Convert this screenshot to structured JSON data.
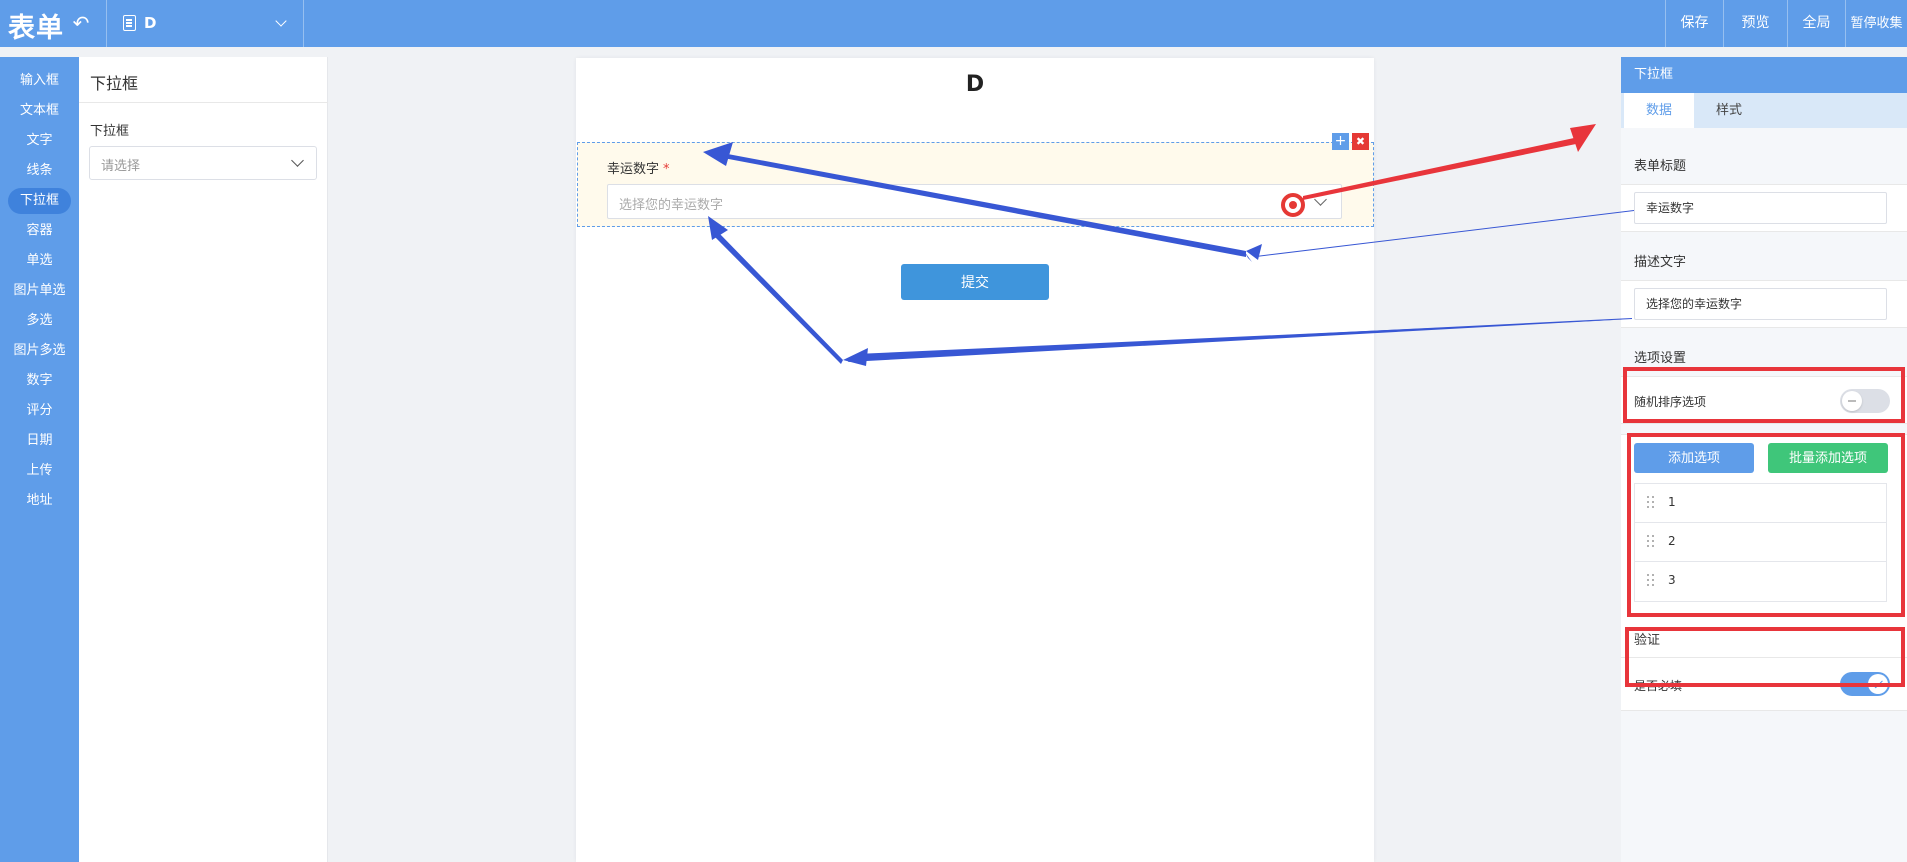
{
  "header": {
    "logo": "表单",
    "doc_name": "D",
    "buttons": [
      "保存",
      "预览",
      "全局",
      "暂停收集"
    ]
  },
  "component_nav": {
    "items": [
      "输入框",
      "文本框",
      "文字",
      "线条",
      "下拉框",
      "容器",
      "单选",
      "图片单选",
      "多选",
      "图片多选",
      "数字",
      "评分",
      "日期",
      "上传",
      "地址"
    ],
    "active": "下拉框"
  },
  "component_panel": {
    "title": "下拉框",
    "field_label": "下拉框",
    "placeholder": "请选择"
  },
  "form": {
    "title": "D",
    "field_label": "幸运数字",
    "required_mark": "*",
    "field_placeholder": "选择您的幸运数字",
    "submit_label": "提交"
  },
  "properties": {
    "header": "下拉框",
    "tabs": [
      "数据",
      "样式"
    ],
    "active_tab": "数据",
    "form_title_label": "表单标题",
    "form_title_value": "幸运数字",
    "description_label": "描述文字",
    "description_value": "选择您的幸运数字",
    "options_section_label": "选项设置",
    "random_order_label": "随机排序选项",
    "random_order_enabled": false,
    "add_option_label": "添加选项",
    "batch_add_label": "批量添加选项",
    "options": [
      "1",
      "2",
      "3"
    ],
    "validation_label": "验证",
    "required_label": "是否必填",
    "required_enabled": true
  },
  "colors": {
    "primary": "#5f9de9",
    "highlight_red": "#e8353b",
    "arrow_blue": "#3857d4",
    "success_green": "#3fc67a",
    "field_bg": "#fffaec"
  }
}
